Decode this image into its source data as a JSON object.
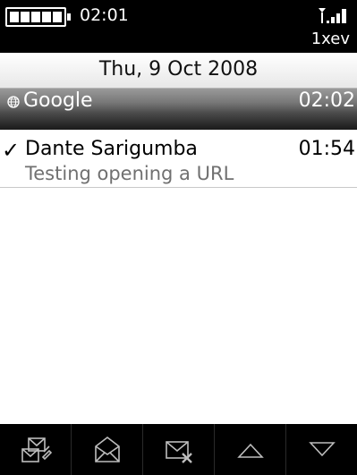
{
  "status": {
    "time": "02:01",
    "network": "1xev"
  },
  "list": {
    "date_header": "Thu, 9 Oct 2008",
    "selected_item": {
      "title": "Google",
      "time": "02:02"
    },
    "messages": [
      {
        "from": "Dante Sarigumba",
        "time": "01:54",
        "subject": "Testing opening a URL",
        "check": "✓"
      }
    ]
  }
}
